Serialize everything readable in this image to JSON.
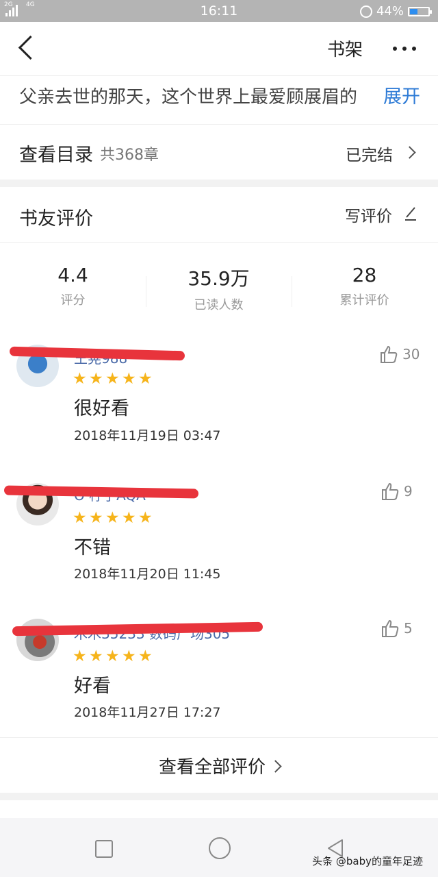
{
  "status_bar": {
    "network_left": "2G",
    "network_right": "4G",
    "time": "16:11",
    "battery": "44%",
    "battery_level": 0.44
  },
  "navbar": {
    "shelf_label": "书架"
  },
  "description": {
    "text": "父亲去世的那天，这个世界上最爱顾展眉的",
    "expand_label": "展开"
  },
  "catalog": {
    "title": "查看目录",
    "count": "共368章",
    "status": "已完结"
  },
  "reviews": {
    "section_title": "书友评价",
    "write_label": "写评价",
    "stats": [
      {
        "value": "4.4",
        "label": "评分"
      },
      {
        "value": "35.9万",
        "label": "已读人数"
      },
      {
        "value": "28",
        "label": "累计评价"
      }
    ],
    "items": [
      {
        "username": "王晃988",
        "rating": 5,
        "text": "很好看",
        "date": "2018年11月19日 03:47",
        "likes": "30"
      },
      {
        "username": "O 柠子AQA",
        "rating": 5,
        "text": "不错",
        "date": "2018年11月20日 11:45",
        "likes": "9"
      },
      {
        "username": "木木35233 数码广场305",
        "rating": 5,
        "text": "好看",
        "date": "2018年11月27日 17:27",
        "likes": "5"
      }
    ],
    "view_all_label": "查看全部评价"
  },
  "watermark": "头条 @baby的童年足迹",
  "colors": {
    "accent_link": "#2e7bd6",
    "star": "#f6b41b",
    "redaction": "#e8343c",
    "username": "#4a6aa8"
  }
}
